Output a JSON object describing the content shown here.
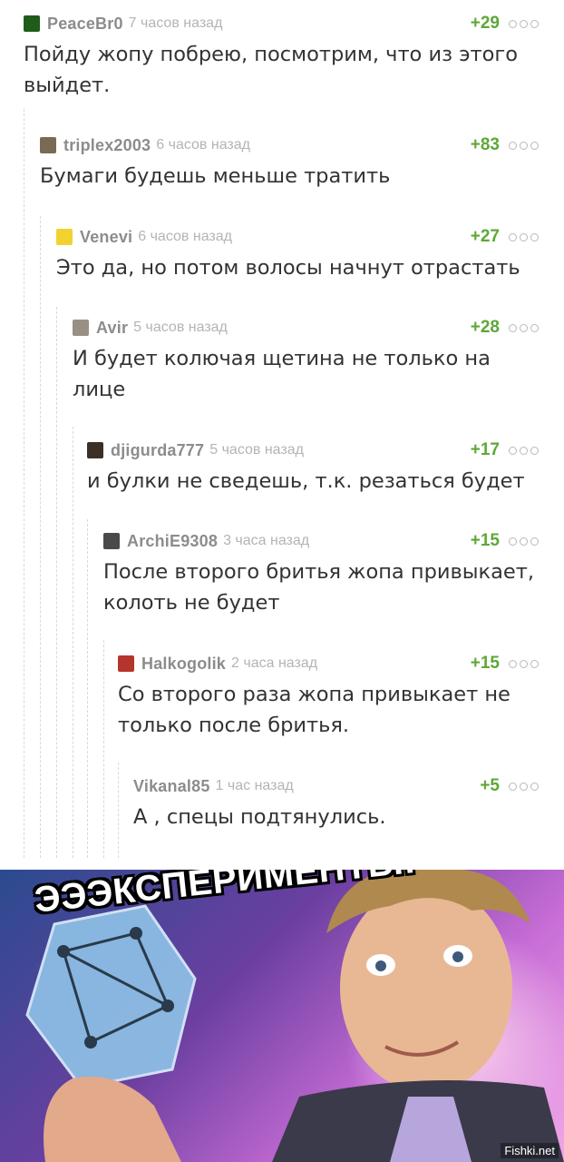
{
  "comments": [
    {
      "author": "PeaceBr0",
      "time": "7 часов назад",
      "rating": "+29",
      "text": "Пойду жопу побрею, посмотрим, что из этого выйдет.",
      "avatar_color": "#1f5c1a"
    },
    {
      "author": "triplex2003",
      "time": "6 часов назад",
      "rating": "+83",
      "text": "Бумаги будешь меньше тратить",
      "avatar_color": "#7a6a55"
    },
    {
      "author": "Venevi",
      "time": "6 часов назад",
      "rating": "+27",
      "text": "Это да, но потом волосы начнут отрастать",
      "avatar_color": "#f2d230"
    },
    {
      "author": "Avir",
      "time": "5 часов назад",
      "rating": "+28",
      "text": "И будет колючая щетина не только на лице",
      "avatar_color": "#9a8f84"
    },
    {
      "author": "djigurda777",
      "time": "5 часов назад",
      "rating": "+17",
      "text": "и булки не сведешь, т.к. резаться будет",
      "avatar_color": "#3a3027"
    },
    {
      "author": "ArchiE9308",
      "time": "3 часа назад",
      "rating": "+15",
      "text": "После второго бритья жопа привыкает, колоть не будет",
      "avatar_color": "#4a4a4a"
    },
    {
      "author": "Halkogolik",
      "time": "2 часа назад",
      "rating": "+15",
      "text": "Со второго раза жопа привыкает не только после бритья.",
      "avatar_color": "#b5342c"
    },
    {
      "author": "Vikanal85",
      "time": "1 час назад",
      "rating": "+5",
      "text": "А , спецы подтянулись."
    }
  ],
  "meme": {
    "caption": "ЭЭЭКСПЕРИМЕНТЫ!",
    "watermark": "Fishki.net"
  },
  "colors": {
    "rating": "#5da837",
    "author": "#8c8c8c",
    "time": "#b4b4b4",
    "text": "#333333"
  }
}
